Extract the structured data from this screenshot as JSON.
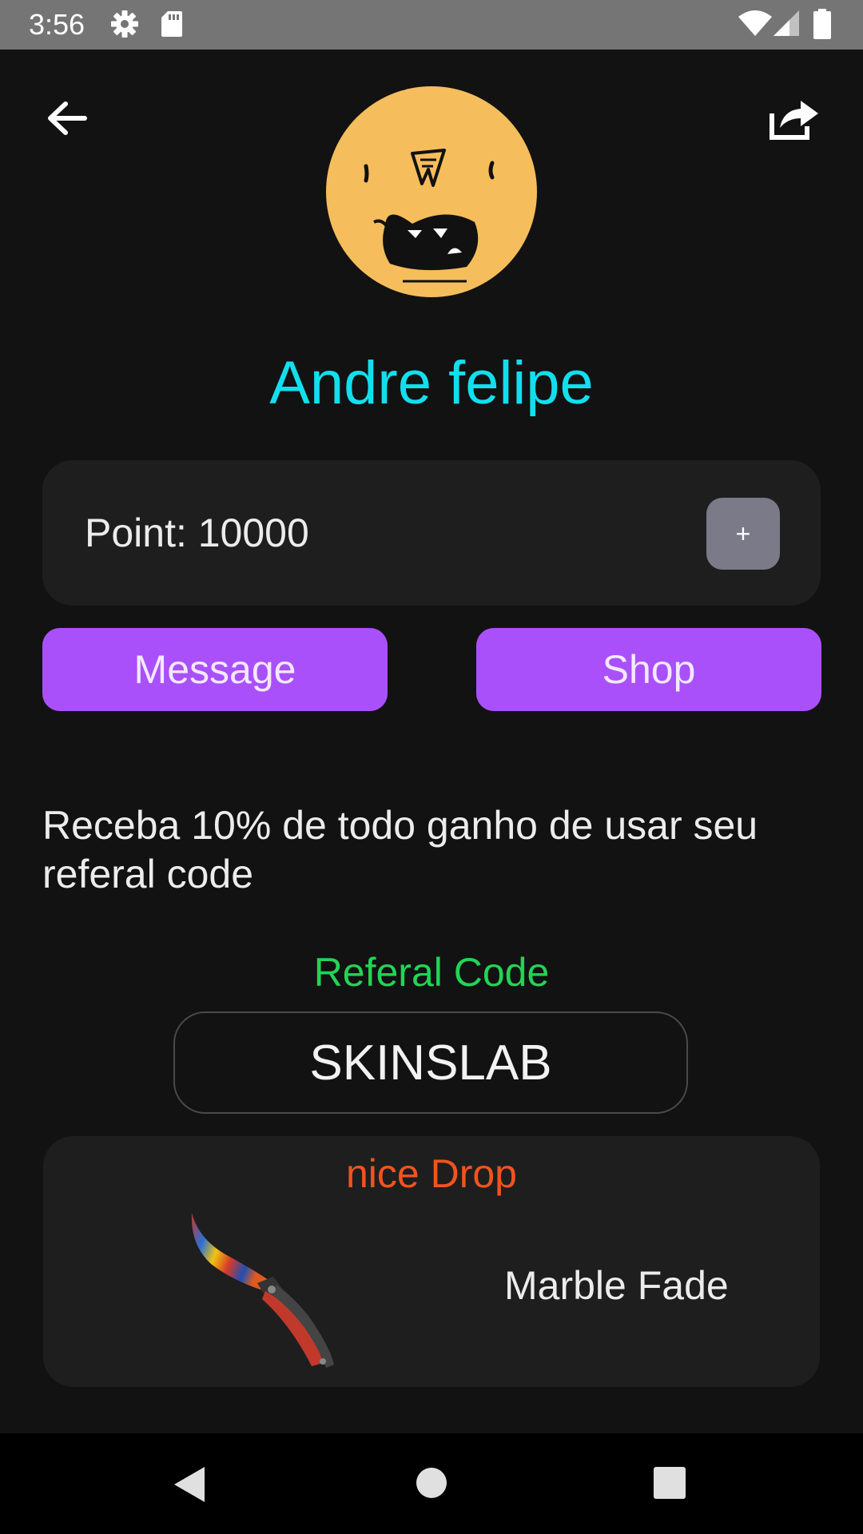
{
  "status_bar": {
    "time": "3:56",
    "icons": [
      "settings-gear-icon",
      "sd-card-icon",
      "wifi-icon",
      "cell-signal-icon",
      "battery-icon"
    ]
  },
  "header": {
    "back_icon": "arrow-left-icon",
    "share_icon": "share-icon"
  },
  "profile": {
    "name": "Andre felipe",
    "avatar_color": "#f5bd5c",
    "name_color": "#12dfee"
  },
  "points": {
    "label": "Point: 10000",
    "add_label": "+"
  },
  "actions": {
    "message_label": "Message",
    "shop_label": "Shop",
    "accent_color": "#aa50fb"
  },
  "referral": {
    "description": "Receba 10% de todo ganho de usar seu referal code",
    "label": "Referal Code",
    "code": "SKINSLAB",
    "label_color": "#22d456"
  },
  "drop": {
    "title": "nice Drop",
    "item_name": "Marble Fade",
    "title_color": "#f0541e"
  },
  "nav_bar": {
    "icons": [
      "nav-back-icon",
      "nav-home-icon",
      "nav-recents-icon"
    ]
  }
}
